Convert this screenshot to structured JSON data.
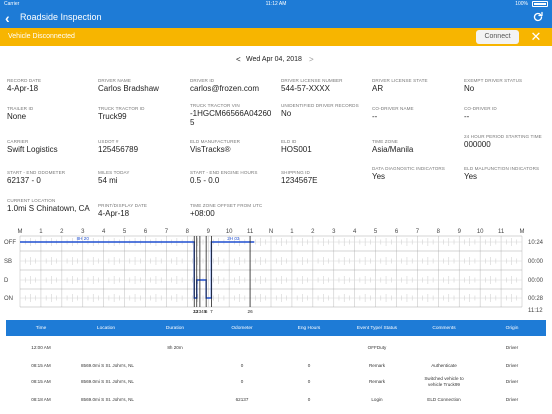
{
  "status_bar": {
    "carrier": "Carrier",
    "time": "11:12 AM",
    "battery": "100%"
  },
  "nav": {
    "back_icon": "chevron-left",
    "title": "Roadside Inspection",
    "refresh_icon": "refresh"
  },
  "alert": {
    "message": "Vehicle Disconnected",
    "button": "Connect",
    "close_icon": "close"
  },
  "date_nav": {
    "prev": "<",
    "date": "Wed Apr 04, 2018",
    "next": ">"
  },
  "fields": [
    {
      "label": "RECORD DATE",
      "value": "4-Apr-18"
    },
    {
      "label": "DRIVER NAME",
      "value": "Carlos Bradshaw"
    },
    {
      "label": "DRIVER ID",
      "value": "carlos@frozen.com"
    },
    {
      "label": "DRIVER LICENSE NUMBER",
      "value": "544-57-XXXX"
    },
    {
      "label": "DRIVER LICENSE STATE",
      "value": "AR"
    },
    {
      "label": "EXEMPT DRIVER STATUS",
      "value": "No"
    },
    {
      "label": "TRAILER ID",
      "value": "None"
    },
    {
      "label": "TRUCK TRACTOR ID",
      "value": "Truck99"
    },
    {
      "label": "TRUCK TRACTOR VIN",
      "value": "-1HGCM66566A04260 5"
    },
    {
      "label": "UNIDENTIFIED DRIVER RECORDS",
      "value": "No"
    },
    {
      "label": "CO-DRIVER NAME",
      "value": "--"
    },
    {
      "label": "CO-DRIVER ID",
      "value": "--"
    },
    {
      "label": "CARRIER",
      "value": "Swift Logistics"
    },
    {
      "label": "USDOT #",
      "value": "125456789"
    },
    {
      "label": "ELD MANUFACTURER",
      "value": "VisTracks®"
    },
    {
      "label": "ELD ID",
      "value": "HOS001"
    },
    {
      "label": "TIME ZONE",
      "value": "Asia/Manila"
    },
    {
      "label": "24 HOUR PERIOD STARTING TIME",
      "value": "000000"
    },
    {
      "label": "START - END ODOMETER",
      "value": "62137 - 0"
    },
    {
      "label": "MILES TODAY",
      "value": "54 mi"
    },
    {
      "label": "START - END ENGINE HOURS",
      "value": "0.5 - 0.0"
    },
    {
      "label": "SHIPPING ID",
      "value": "1234567E"
    },
    {
      "label": "DATA DIAGNOSTIC INDICATORS",
      "value": "Yes"
    },
    {
      "label": "ELD MALFUNCTION INDICATORS",
      "value": "Yes"
    },
    {
      "label": "CURRENT LOCATION",
      "value": "1.0mi S Chinatown, CA"
    },
    {
      "label": "PRINT/DISPLAY DATE",
      "value": "4-Apr-18"
    },
    {
      "label": "TIME ZONE OFFSET FROM UTC",
      "value": "+08:00"
    }
  ],
  "chart_data": {
    "type": "line",
    "title": "",
    "x_ticks": [
      "M",
      "1",
      "2",
      "3",
      "4",
      "5",
      "6",
      "7",
      "8",
      "9",
      "10",
      "11",
      "N",
      "1",
      "2",
      "3",
      "4",
      "5",
      "6",
      "7",
      "8",
      "9",
      "10",
      "11",
      "M"
    ],
    "rows": [
      "OFF",
      "SB",
      "D",
      "ON"
    ],
    "row_totals": [
      "10:24",
      "00:00",
      "00:00",
      "00:28"
    ],
    "grand_total": "11:12",
    "xlim": [
      0,
      24
    ],
    "series": [
      {
        "segments": [
          {
            "status": "OFF",
            "start": 0.0,
            "end": 8.33
          },
          {
            "status": "ON",
            "start": 8.33,
            "end": 8.45
          },
          {
            "status": "D",
            "start": 8.45,
            "end": 8.9
          },
          {
            "status": "ON",
            "start": 8.9,
            "end": 9.15
          },
          {
            "status": "OFF",
            "start": 9.15,
            "end": 11.2
          }
        ]
      }
    ],
    "annotations": [
      {
        "x": 3.0,
        "text": "8H 20"
      },
      {
        "x": 10.2,
        "text": "2H 03"
      }
    ],
    "event_marks": [
      {
        "x": 8.33,
        "text": "2"
      },
      {
        "x": 8.45,
        "text": "3"
      },
      {
        "x": 8.6,
        "text": "12345"
      },
      {
        "x": 8.9,
        "text": "6"
      },
      {
        "x": 9.15,
        "text": "7"
      },
      {
        "x": 11.0,
        "text": "26"
      }
    ]
  },
  "table": {
    "headers": [
      "Time",
      "Location",
      "Duration",
      "Odometer",
      "Eng Hours",
      "Event Type/ Status",
      "Comments",
      "Origin"
    ],
    "rows": [
      {
        "time": "12:00 AM",
        "location": "",
        "duration": "8h 20m",
        "odometer": "",
        "eng_hours": "",
        "event": "OFFDuty",
        "comments": "",
        "origin": "Driver"
      },
      {
        "time": "08:15 AM",
        "location": "8569.0mi S St. John's, NL",
        "duration": "",
        "odometer": "0",
        "eng_hours": "0",
        "event": "Remark",
        "comments": "Authenticate",
        "origin": "Driver"
      },
      {
        "time": "08:15 AM",
        "location": "8569.0mi S St. John's, NL",
        "duration": "",
        "odometer": "0",
        "eng_hours": "0",
        "event": "Remark",
        "comments": "Switched vehicle to vehicle Truck99",
        "origin": "Driver"
      },
      {
        "time": "08:18 AM",
        "location": "8569.0mi S St. John's, NL",
        "duration": "",
        "odometer": "62137",
        "eng_hours": "0",
        "event": "Login",
        "comments": "ELD Connection",
        "origin": "Driver"
      }
    ]
  },
  "colors": {
    "primary": "#1e7bd6",
    "alert": "#f7b500",
    "chart_line": "#1f4fd1"
  }
}
